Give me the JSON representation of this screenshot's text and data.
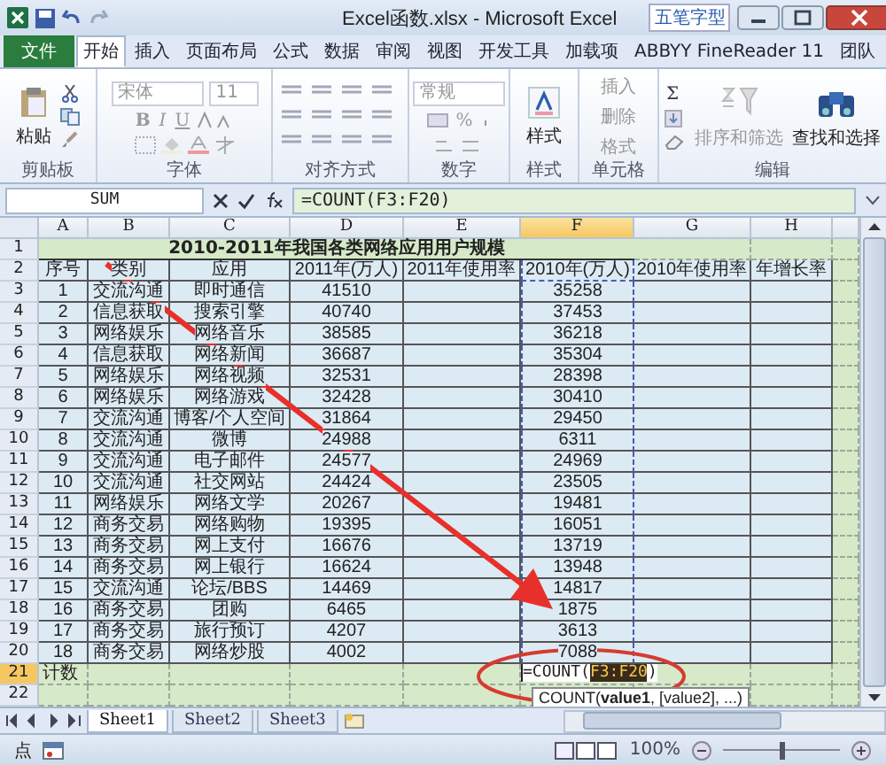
{
  "title_bar": {
    "title": "Excel函数.xlsx - Microsoft Excel",
    "ime": "五笔字型"
  },
  "file_menu": "文件",
  "ribbon_tabs": [
    {
      "label": "开始",
      "selected": true
    },
    {
      "label": "插入",
      "selected": false
    },
    {
      "label": "页面布局",
      "selected": false
    },
    {
      "label": "公式",
      "selected": false
    },
    {
      "label": "数据",
      "selected": false
    },
    {
      "label": "审阅",
      "selected": false
    },
    {
      "label": "视图",
      "selected": false
    },
    {
      "label": "开发工具",
      "selected": false
    },
    {
      "label": "加载项",
      "selected": false
    },
    {
      "label": "ABBYY FineReader 11",
      "selected": false
    },
    {
      "label": "团队",
      "selected": false
    }
  ],
  "ribbon_groups": [
    {
      "label": "剪贴板",
      "kind": "clipboard",
      "paste": "粘贴"
    },
    {
      "label": "字体",
      "kind": "font",
      "font": "宋体",
      "size": "11",
      "buttons": [
        "B",
        "I",
        "U"
      ]
    },
    {
      "label": "对齐方式",
      "kind": "align"
    },
    {
      "label": "数字",
      "kind": "number",
      "format": "常规",
      "percent": "%"
    },
    {
      "label": "样式",
      "kind": "styles",
      "button": "样式"
    },
    {
      "label": "单元格",
      "kind": "cells",
      "items": [
        "插入",
        "删除",
        "格式"
      ]
    },
    {
      "label": "编辑",
      "kind": "editing",
      "sigma": "Σ",
      "items": [
        "排序和筛选",
        "查找和选择"
      ]
    }
  ],
  "formula_bar": {
    "name_box": "SUM",
    "formula": "=COUNT(F3:F20)"
  },
  "sheet": {
    "columns": [
      {
        "label": "A",
        "selected": false
      },
      {
        "label": "B",
        "selected": false
      },
      {
        "label": "C",
        "selected": false
      },
      {
        "label": "D",
        "selected": false
      },
      {
        "label": "E",
        "selected": false
      },
      {
        "label": "F",
        "selected": true
      },
      {
        "label": "G",
        "selected": false
      },
      {
        "label": "H",
        "selected": false
      }
    ],
    "title_row": {
      "number": "1",
      "text": "2010-2011年我国各类网络应用用户规模"
    },
    "header_row": {
      "number": "2",
      "cells": [
        "序号",
        "类别",
        "应用",
        "2011年(万人)",
        "2011年使用率",
        "2010年(万人)",
        "2010年使用率",
        "年增长率"
      ]
    },
    "rows": [
      {
        "number": "3",
        "seq": "1",
        "category": "交流沟通",
        "app": "即时通信",
        "users_2011": "41510",
        "users_2010": "35258"
      },
      {
        "number": "4",
        "seq": "2",
        "category": "信息获取",
        "app": "搜索引擎",
        "users_2011": "40740",
        "users_2010": "37453"
      },
      {
        "number": "5",
        "seq": "3",
        "category": "网络娱乐",
        "app": "网络音乐",
        "users_2011": "38585",
        "users_2010": "36218"
      },
      {
        "number": "6",
        "seq": "4",
        "category": "信息获取",
        "app": "网络新闻",
        "users_2011": "36687",
        "users_2010": "35304"
      },
      {
        "number": "7",
        "seq": "5",
        "category": "网络娱乐",
        "app": "网络视频",
        "users_2011": "32531",
        "users_2010": "28398"
      },
      {
        "number": "8",
        "seq": "6",
        "category": "网络娱乐",
        "app": "网络游戏",
        "users_2011": "32428",
        "users_2010": "30410"
      },
      {
        "number": "9",
        "seq": "7",
        "category": "交流沟通",
        "app": "博客/个人空间",
        "users_2011": "31864",
        "users_2010": "29450"
      },
      {
        "number": "10",
        "seq": "8",
        "category": "交流沟通",
        "app": "微博",
        "users_2011": "24988",
        "users_2010": "6311"
      },
      {
        "number": "11",
        "seq": "9",
        "category": "交流沟通",
        "app": "电子邮件",
        "users_2011": "24577",
        "users_2010": "24969"
      },
      {
        "number": "12",
        "seq": "10",
        "category": "交流沟通",
        "app": "社交网站",
        "users_2011": "24424",
        "users_2010": "23505"
      },
      {
        "number": "13",
        "seq": "11",
        "category": "网络娱乐",
        "app": "网络文学",
        "users_2011": "20267",
        "users_2010": "19481"
      },
      {
        "number": "14",
        "seq": "12",
        "category": "商务交易",
        "app": "网络购物",
        "users_2011": "19395",
        "users_2010": "16051"
      },
      {
        "number": "15",
        "seq": "13",
        "category": "商务交易",
        "app": "网上支付",
        "users_2011": "16676",
        "users_2010": "13719"
      },
      {
        "number": "16",
        "seq": "14",
        "category": "商务交易",
        "app": "网上银行",
        "users_2011": "16624",
        "users_2010": "13948"
      },
      {
        "number": "17",
        "seq": "15",
        "category": "交流沟通",
        "app": "论坛/BBS",
        "users_2011": "14469",
        "users_2010": "14817"
      },
      {
        "number": "18",
        "seq": "16",
        "category": "商务交易",
        "app": "团购",
        "users_2011": "6465",
        "users_2010": "1875"
      },
      {
        "number": "19",
        "seq": "17",
        "category": "商务交易",
        "app": "旅行预订",
        "users_2011": "4207",
        "users_2010": "3613"
      },
      {
        "number": "20",
        "seq": "18",
        "category": "商务交易",
        "app": "网络炒股",
        "users_2011": "4002",
        "users_2010": "7088"
      }
    ],
    "total_row": {
      "number": "21",
      "selected": true,
      "label": "计数",
      "formula_start": "=COUNT(",
      "formula_ref": "F3:F20",
      "formula_end": ")"
    },
    "empty_rows": [
      {
        "number": "22"
      }
    ],
    "tooltip": "COUNT(**value1**, [value2], ...)"
  },
  "sheet_tabs": [
    {
      "label": "Sheet1",
      "selected": true
    },
    {
      "label": "Sheet2",
      "selected": false
    },
    {
      "label": "Sheet3",
      "selected": false
    }
  ],
  "status_bar": {
    "mode": "点",
    "zoom": "100%",
    "zoom_slider": {
      "level": 0.5
    }
  }
}
